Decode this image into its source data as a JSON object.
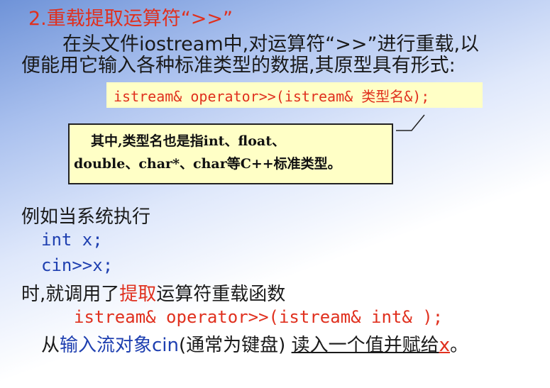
{
  "title": "2.重载提取运算符“>>”",
  "intro": {
    "line1": "在头文件iostream中,对运算符“>>”进行重载,以",
    "line2": "便能用它输入各种标准类型的数据,其原型具有形式:"
  },
  "prototype": "istream& operator>>(istream& 类型名&);",
  "note": {
    "line1": "其中,类型名也是指int、float、",
    "line2": "double、char*、char等C++标准类型。"
  },
  "example": {
    "lead": "例如当系统执行",
    "code_line1": "int x;",
    "code_line2": "cin>>x;",
    "call_prefix": "时,就调用了",
    "call_highlight": "提取",
    "call_suffix": "运算符重载函数",
    "call_code": "istream& operator>>(istream& int& );",
    "from_prefix": "从",
    "from_blue1": "输入流对象cin",
    "from_mid": "(通常为键盘)",
    "from_underlined": "读入一个值并赋给",
    "from_var": "x",
    "from_end": "。"
  },
  "colors": {
    "title": "#e0301e",
    "highlight_box": "#ffffc6",
    "code_blue": "#1e3fb0",
    "code_red": "#e0301e"
  }
}
